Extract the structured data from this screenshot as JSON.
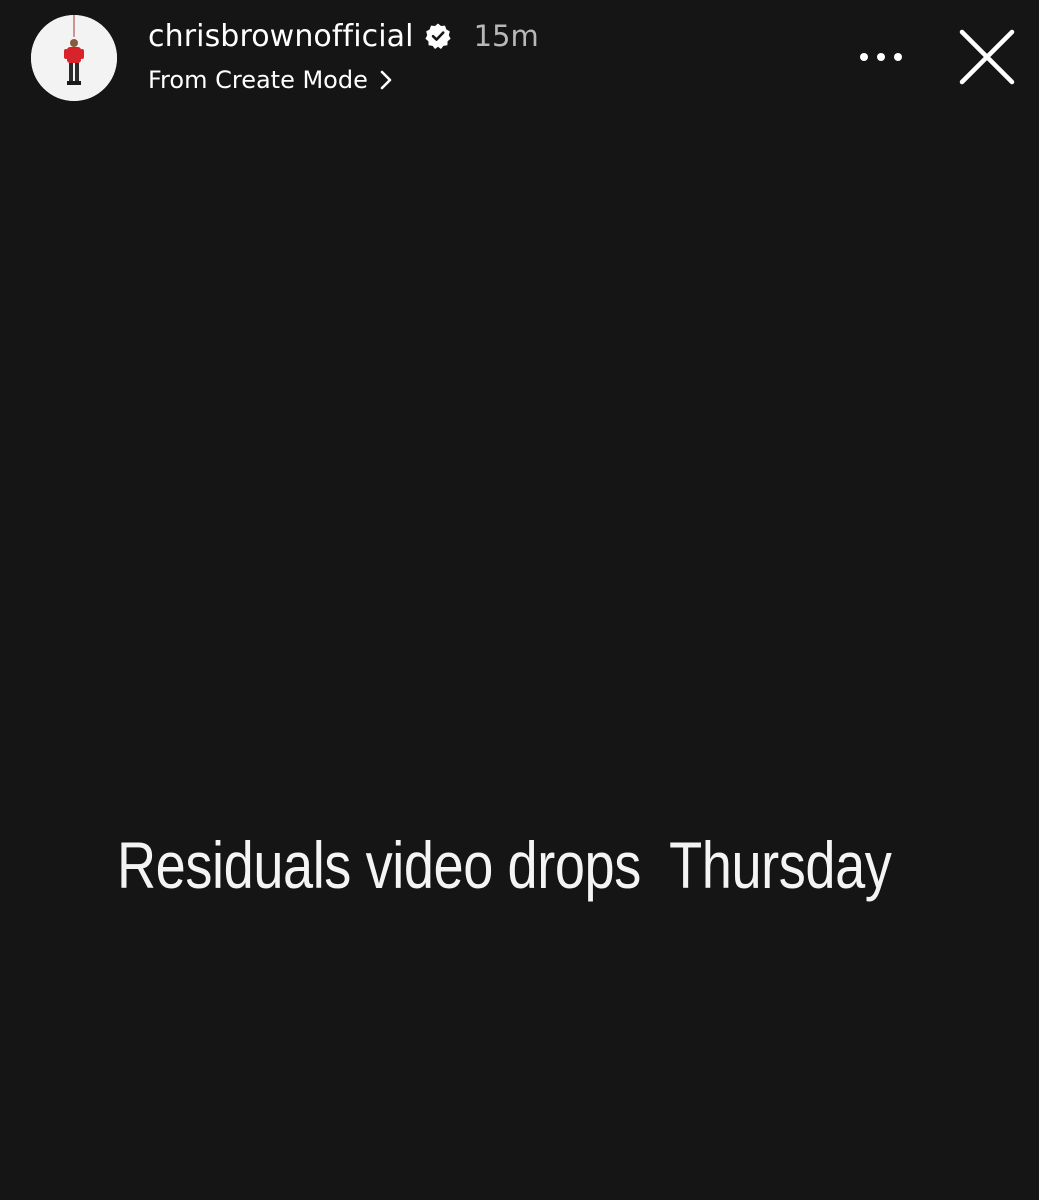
{
  "story": {
    "header": {
      "username": "chrisbrownofficial",
      "verified": true,
      "timestamp": "15m",
      "subtitle": "From Create Mode",
      "avatar_icon": "avatar-figure-red-jacket",
      "more_icon": "more-horizontal-icon",
      "close_icon": "close-icon"
    },
    "caption": "Residuals video drops  Thursday",
    "colors": {
      "background": "#151515",
      "text": "#ffffff",
      "timestamp": "#b8b8b8",
      "avatar_bg": "#f3f3f3",
      "avatar_jacket": "#d8232a"
    }
  }
}
